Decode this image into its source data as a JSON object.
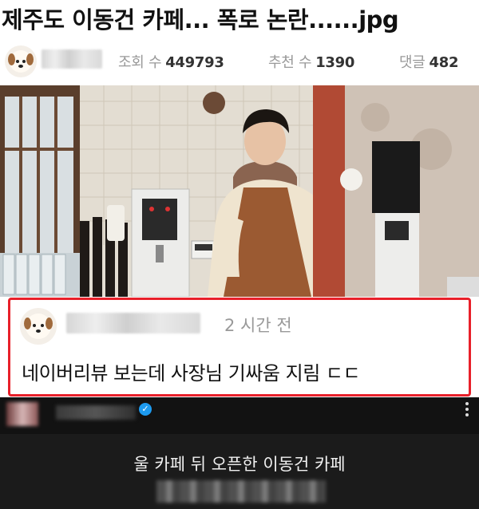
{
  "post": {
    "title": "제주도 이동건 카페... 폭로 논란......jpg"
  },
  "meta": {
    "views_label": "조회 수",
    "views_value": "449793",
    "recommend_label": "추천 수",
    "recommend_value": "1390",
    "comments_label": "댓글",
    "comments_value": "482"
  },
  "comment": {
    "time": "2 시간 전",
    "text": "네이버리뷰 보는데 사장님 기싸움 지림 ㄷㄷ"
  },
  "video": {
    "caption": "울 카페 뒤 오픈한 이동건 카페"
  },
  "colors": {
    "highlight_border": "#e8202a",
    "verified_badge": "#1d9bf0"
  },
  "icons": {
    "author_avatar": "puppy-avatar-icon",
    "commenter_avatar": "puppy-avatar-icon",
    "verified": "verified-badge-icon",
    "more": "more-vertical-icon"
  }
}
